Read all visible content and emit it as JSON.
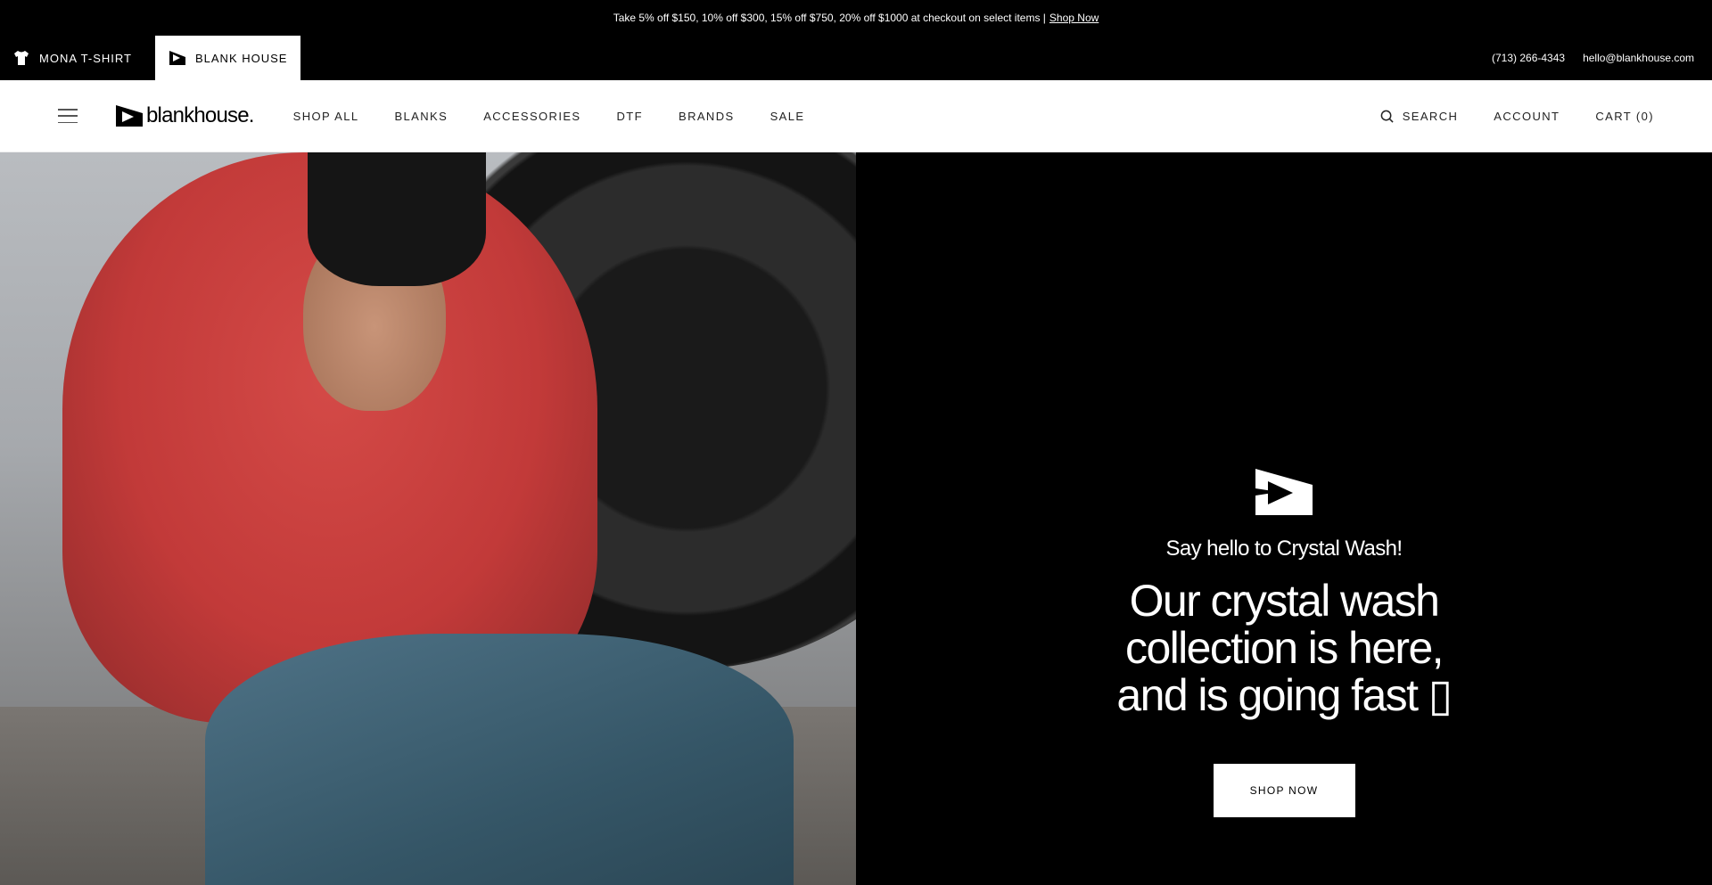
{
  "announcement": {
    "text": "Take 5% off $150, 10% off $300, 15% off $750, 20% off $1000 at checkout on select items |",
    "link": "Shop Now"
  },
  "switcher": {
    "stores": [
      {
        "label": "MONA T-SHIRT",
        "icon": "tshirt-icon"
      },
      {
        "label": "BLANK HOUSE",
        "icon": "blankhouse-logo-icon"
      }
    ],
    "phone": "(713) 266-4343",
    "email": "hello@blankhouse.com"
  },
  "nav": {
    "logo_text": "blankhouse.",
    "menu": [
      "SHOP ALL",
      "BLANKS",
      "ACCESSORIES",
      "DTF",
      "BRANDS",
      "SALE"
    ],
    "search": "SEARCH",
    "account": "ACCOUNT",
    "cart": "CART (0)"
  },
  "hero": {
    "subtitle": "Say hello to Crystal Wash!",
    "title": "Our crystal wash collection is here, and is going fast ▯",
    "button": "SHOP NOW"
  },
  "colors": {
    "background": "#000000",
    "nav_background": "#ffffff",
    "hoodie_red": "#c23a39"
  }
}
